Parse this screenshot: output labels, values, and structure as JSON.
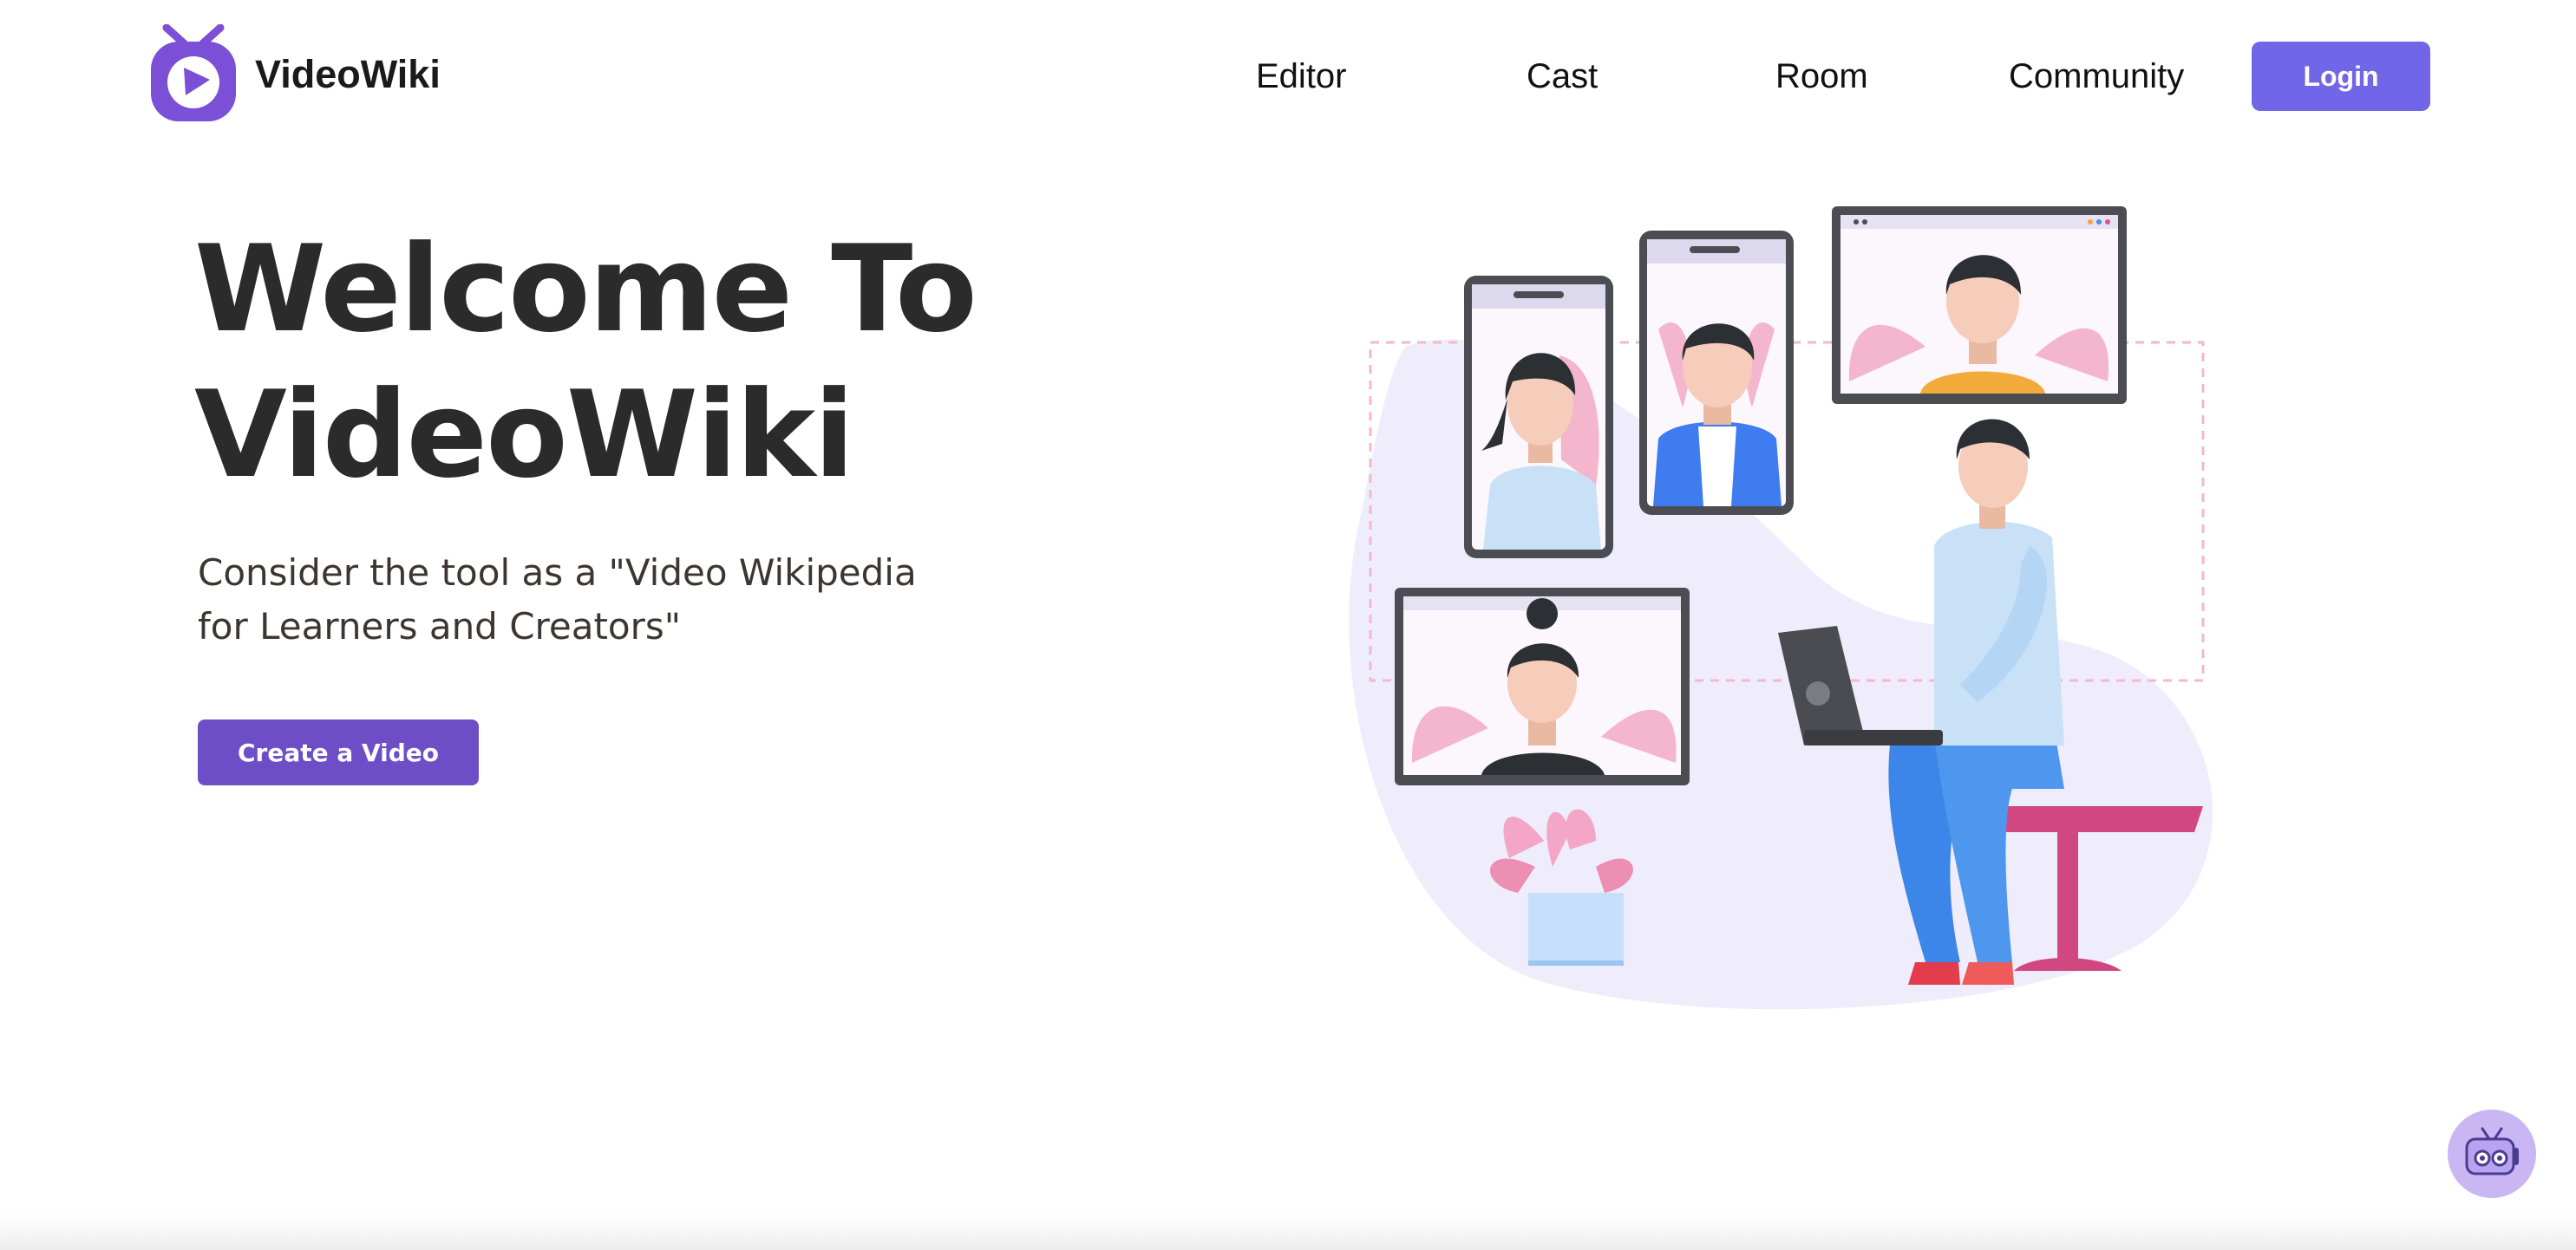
{
  "brand": {
    "name": "VideoWiki",
    "color": "#7b4fd6",
    "logo_icon": "tv-play-icon"
  },
  "nav": {
    "items": [
      {
        "label": "Editor"
      },
      {
        "label": "Cast"
      },
      {
        "label": "Room"
      },
      {
        "label": "Community"
      }
    ],
    "login_label": "Login"
  },
  "hero": {
    "title_line1": "Welcome To",
    "title_line2": "VideoWiki",
    "subtitle_line1": "Consider the tool as a \"Video Wikipedia",
    "subtitle_line2": "for Learners and Creators\"",
    "cta_label": "Create a Video"
  },
  "colors": {
    "accent": "#7266e8",
    "cta": "#6d4ec7",
    "title": "#2b2b2b",
    "pink": "#f3a6c6"
  },
  "chatbot": {
    "icon": "robot-tv-icon"
  }
}
